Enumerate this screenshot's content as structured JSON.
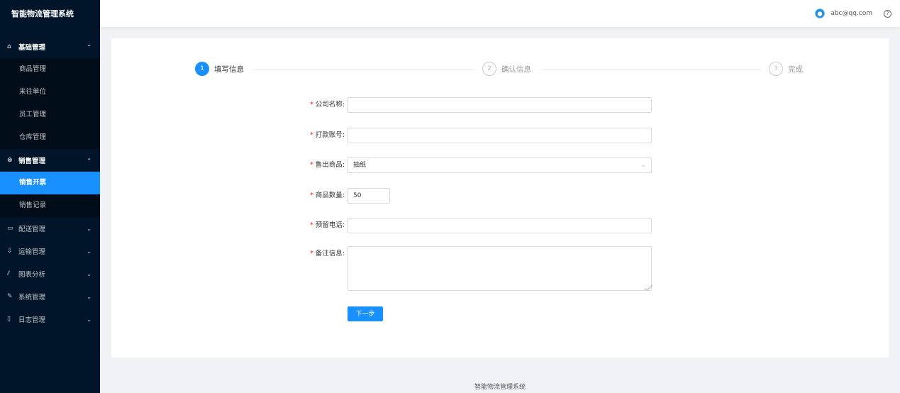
{
  "app": {
    "title": "智能物流管理系统"
  },
  "header": {
    "user": "abc@qq.com",
    "help_icon": "?"
  },
  "sidebar": {
    "groups": [
      {
        "icon": "⌂",
        "label": "基础管理",
        "arrow": "⌃",
        "items": [
          {
            "label": "商品管理"
          },
          {
            "label": "来往单位"
          },
          {
            "label": "员工管理"
          },
          {
            "label": "仓库管理"
          }
        ]
      },
      {
        "icon": "⊗",
        "label": "销售管理",
        "arrow": "⌃",
        "items": [
          {
            "label": "销售开票"
          },
          {
            "label": "销售记录"
          }
        ]
      },
      {
        "icon": "▭",
        "label": "配送管理",
        "arrow": "⌄"
      },
      {
        "icon": "⇩",
        "label": "运输管理",
        "arrow": "⌄"
      },
      {
        "icon": "⫽",
        "label": "图表分析",
        "arrow": "⌄"
      },
      {
        "icon": "✎",
        "label": "系统管理",
        "arrow": "⌄"
      },
      {
        "icon": "▯",
        "label": "日志管理",
        "arrow": "⌄"
      }
    ],
    "active_item": "销售开票"
  },
  "steps": [
    {
      "num": "1",
      "title": "填写信息"
    },
    {
      "num": "2",
      "title": "确认信息"
    },
    {
      "num": "3",
      "title": "完成"
    }
  ],
  "form": {
    "required_mark": "*",
    "fields": [
      {
        "label": "公司名称:",
        "value": ""
      },
      {
        "label": "打款账号:",
        "value": ""
      },
      {
        "label": "售出商品:",
        "value": "抽纸",
        "chevron": "⌄"
      },
      {
        "label": "商品数量:",
        "value": "50"
      },
      {
        "label": "预留电话:",
        "value": ""
      },
      {
        "label": "备注信息:",
        "value": ""
      }
    ],
    "next_button": "下一步"
  },
  "footer": {
    "text": "智能物流管理系统"
  },
  "colors": {
    "primary": "#1890ff",
    "sidebar": "#001529",
    "submenu": "#000c17",
    "required": "#f5222d"
  }
}
